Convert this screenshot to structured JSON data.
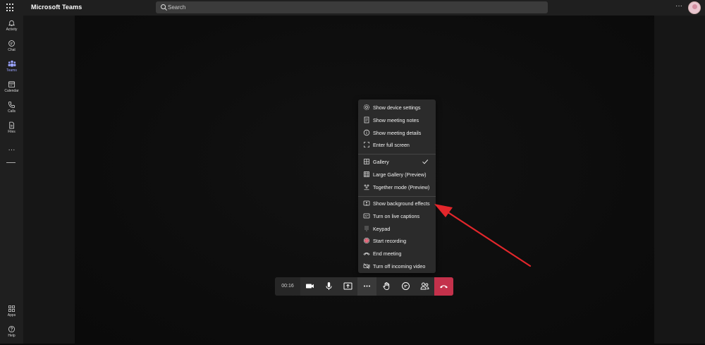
{
  "topbar": {
    "app_title": "Microsoft Teams",
    "search_placeholder": "Search",
    "more_label": "···"
  },
  "rail": {
    "items": [
      {
        "label": "Activity",
        "icon": "bell-icon"
      },
      {
        "label": "Chat",
        "icon": "chat-icon"
      },
      {
        "label": "Teams",
        "icon": "teams-icon"
      },
      {
        "label": "Calendar",
        "icon": "calendar-icon"
      },
      {
        "label": "Calls",
        "icon": "phone-icon"
      },
      {
        "label": "Files",
        "icon": "file-icon"
      }
    ],
    "more_label": "···",
    "bottom": [
      {
        "label": "Apps",
        "icon": "apps-icon"
      },
      {
        "label": "Help",
        "icon": "help-icon"
      }
    ]
  },
  "menu": {
    "items": [
      {
        "label": "Show device settings",
        "icon": "gear-icon"
      },
      {
        "label": "Show meeting notes",
        "icon": "notes-icon"
      },
      {
        "label": "Show meeting details",
        "icon": "info-icon"
      },
      {
        "label": "Enter full screen",
        "icon": "fullscreen-icon"
      },
      {
        "label": "Gallery",
        "icon": "gallery-icon",
        "checked": true
      },
      {
        "label": "Large Gallery (Preview)",
        "icon": "large-gallery-icon"
      },
      {
        "label": "Together mode (Preview)",
        "icon": "together-mode-icon"
      },
      {
        "label": "Show background effects",
        "icon": "background-effects-icon"
      },
      {
        "label": "Turn on live captions",
        "icon": "captions-icon"
      },
      {
        "label": "Keypad",
        "icon": "keypad-icon"
      },
      {
        "label": "Start recording",
        "icon": "record-icon"
      },
      {
        "label": "End meeting",
        "icon": "end-meeting-icon"
      },
      {
        "label": "Turn off incoming video",
        "icon": "video-off-icon"
      }
    ]
  },
  "controls": {
    "timer": "00:16",
    "buttons": [
      "camera-icon",
      "microphone-icon",
      "share-screen-icon",
      "more-actions-icon",
      "raise-hand-icon",
      "chat-icon",
      "participants-icon",
      "hang-up-icon"
    ]
  },
  "colors": {
    "hangup": "#c4314b",
    "annotation_arrow": "#e3262b",
    "accent": "#9aa3ff"
  }
}
